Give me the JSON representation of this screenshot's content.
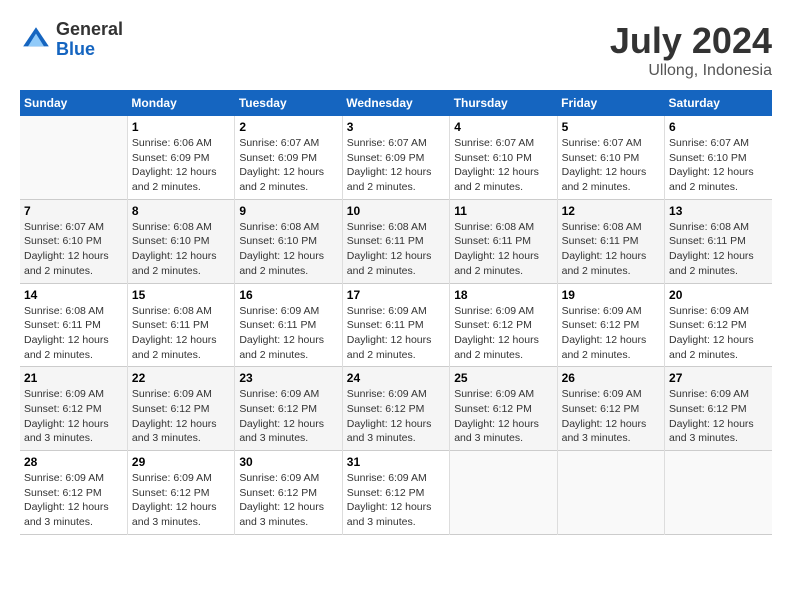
{
  "header": {
    "logo_general": "General",
    "logo_blue": "Blue",
    "month_year": "July 2024",
    "location": "Ullong, Indonesia"
  },
  "calendar": {
    "days_of_week": [
      "Sunday",
      "Monday",
      "Tuesday",
      "Wednesday",
      "Thursday",
      "Friday",
      "Saturday"
    ],
    "weeks": [
      [
        {
          "num": "",
          "info": ""
        },
        {
          "num": "1",
          "info": "Sunrise: 6:06 AM\nSunset: 6:09 PM\nDaylight: 12 hours\nand 2 minutes."
        },
        {
          "num": "2",
          "info": "Sunrise: 6:07 AM\nSunset: 6:09 PM\nDaylight: 12 hours\nand 2 minutes."
        },
        {
          "num": "3",
          "info": "Sunrise: 6:07 AM\nSunset: 6:09 PM\nDaylight: 12 hours\nand 2 minutes."
        },
        {
          "num": "4",
          "info": "Sunrise: 6:07 AM\nSunset: 6:10 PM\nDaylight: 12 hours\nand 2 minutes."
        },
        {
          "num": "5",
          "info": "Sunrise: 6:07 AM\nSunset: 6:10 PM\nDaylight: 12 hours\nand 2 minutes."
        },
        {
          "num": "6",
          "info": "Sunrise: 6:07 AM\nSunset: 6:10 PM\nDaylight: 12 hours\nand 2 minutes."
        }
      ],
      [
        {
          "num": "7",
          "info": "Sunrise: 6:07 AM\nSunset: 6:10 PM\nDaylight: 12 hours\nand 2 minutes."
        },
        {
          "num": "8",
          "info": "Sunrise: 6:08 AM\nSunset: 6:10 PM\nDaylight: 12 hours\nand 2 minutes."
        },
        {
          "num": "9",
          "info": "Sunrise: 6:08 AM\nSunset: 6:10 PM\nDaylight: 12 hours\nand 2 minutes."
        },
        {
          "num": "10",
          "info": "Sunrise: 6:08 AM\nSunset: 6:11 PM\nDaylight: 12 hours\nand 2 minutes."
        },
        {
          "num": "11",
          "info": "Sunrise: 6:08 AM\nSunset: 6:11 PM\nDaylight: 12 hours\nand 2 minutes."
        },
        {
          "num": "12",
          "info": "Sunrise: 6:08 AM\nSunset: 6:11 PM\nDaylight: 12 hours\nand 2 minutes."
        },
        {
          "num": "13",
          "info": "Sunrise: 6:08 AM\nSunset: 6:11 PM\nDaylight: 12 hours\nand 2 minutes."
        }
      ],
      [
        {
          "num": "14",
          "info": "Sunrise: 6:08 AM\nSunset: 6:11 PM\nDaylight: 12 hours\nand 2 minutes."
        },
        {
          "num": "15",
          "info": "Sunrise: 6:08 AM\nSunset: 6:11 PM\nDaylight: 12 hours\nand 2 minutes."
        },
        {
          "num": "16",
          "info": "Sunrise: 6:09 AM\nSunset: 6:11 PM\nDaylight: 12 hours\nand 2 minutes."
        },
        {
          "num": "17",
          "info": "Sunrise: 6:09 AM\nSunset: 6:11 PM\nDaylight: 12 hours\nand 2 minutes."
        },
        {
          "num": "18",
          "info": "Sunrise: 6:09 AM\nSunset: 6:12 PM\nDaylight: 12 hours\nand 2 minutes."
        },
        {
          "num": "19",
          "info": "Sunrise: 6:09 AM\nSunset: 6:12 PM\nDaylight: 12 hours\nand 2 minutes."
        },
        {
          "num": "20",
          "info": "Sunrise: 6:09 AM\nSunset: 6:12 PM\nDaylight: 12 hours\nand 2 minutes."
        }
      ],
      [
        {
          "num": "21",
          "info": "Sunrise: 6:09 AM\nSunset: 6:12 PM\nDaylight: 12 hours\nand 3 minutes."
        },
        {
          "num": "22",
          "info": "Sunrise: 6:09 AM\nSunset: 6:12 PM\nDaylight: 12 hours\nand 3 minutes."
        },
        {
          "num": "23",
          "info": "Sunrise: 6:09 AM\nSunset: 6:12 PM\nDaylight: 12 hours\nand 3 minutes."
        },
        {
          "num": "24",
          "info": "Sunrise: 6:09 AM\nSunset: 6:12 PM\nDaylight: 12 hours\nand 3 minutes."
        },
        {
          "num": "25",
          "info": "Sunrise: 6:09 AM\nSunset: 6:12 PM\nDaylight: 12 hours\nand 3 minutes."
        },
        {
          "num": "26",
          "info": "Sunrise: 6:09 AM\nSunset: 6:12 PM\nDaylight: 12 hours\nand 3 minutes."
        },
        {
          "num": "27",
          "info": "Sunrise: 6:09 AM\nSunset: 6:12 PM\nDaylight: 12 hours\nand 3 minutes."
        }
      ],
      [
        {
          "num": "28",
          "info": "Sunrise: 6:09 AM\nSunset: 6:12 PM\nDaylight: 12 hours\nand 3 minutes."
        },
        {
          "num": "29",
          "info": "Sunrise: 6:09 AM\nSunset: 6:12 PM\nDaylight: 12 hours\nand 3 minutes."
        },
        {
          "num": "30",
          "info": "Sunrise: 6:09 AM\nSunset: 6:12 PM\nDaylight: 12 hours\nand 3 minutes."
        },
        {
          "num": "31",
          "info": "Sunrise: 6:09 AM\nSunset: 6:12 PM\nDaylight: 12 hours\nand 3 minutes."
        },
        {
          "num": "",
          "info": ""
        },
        {
          "num": "",
          "info": ""
        },
        {
          "num": "",
          "info": ""
        }
      ]
    ]
  }
}
